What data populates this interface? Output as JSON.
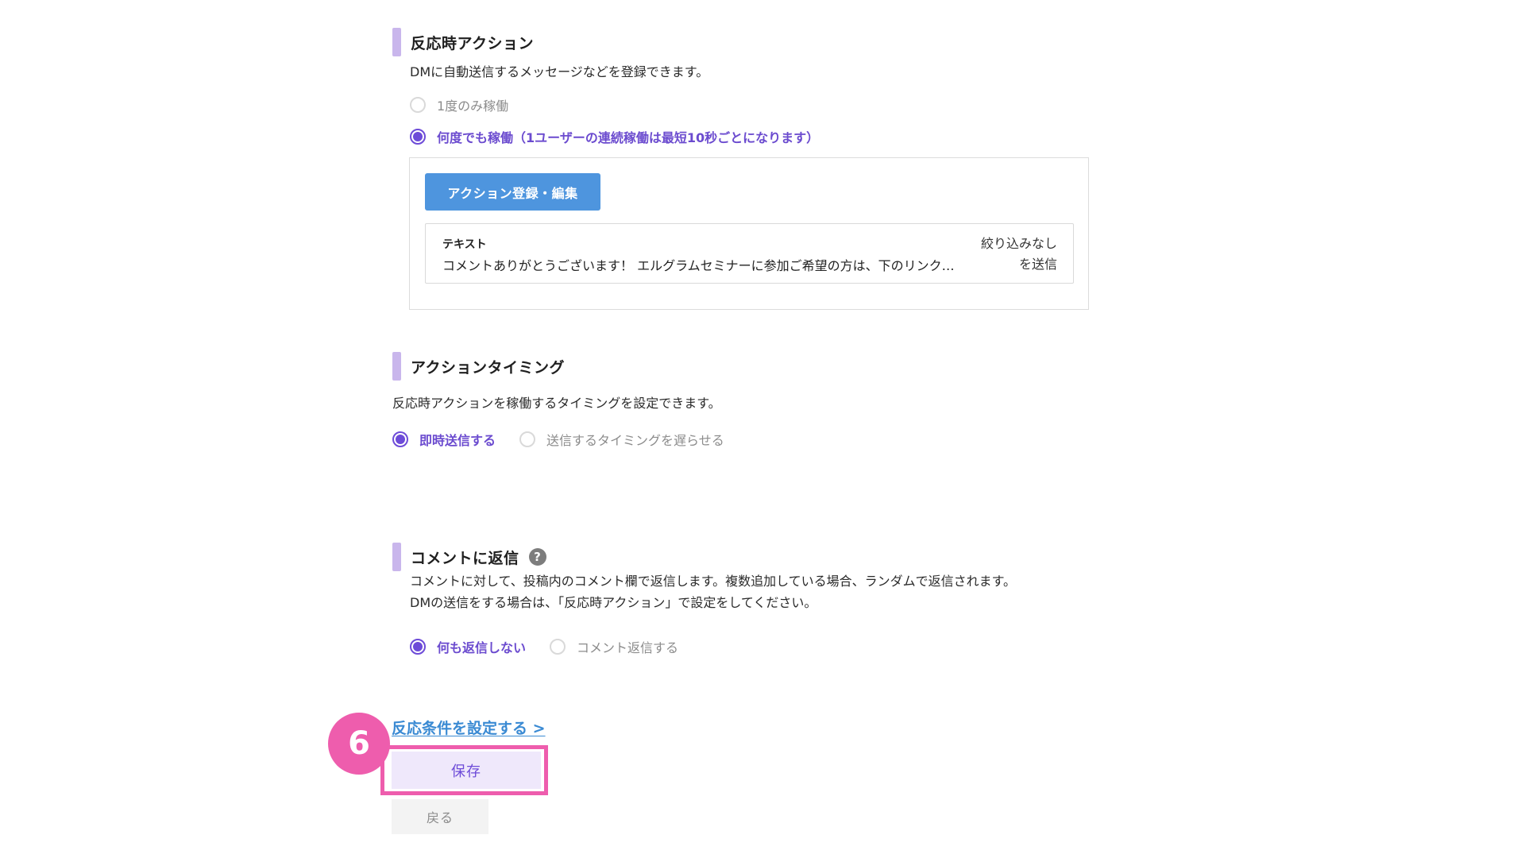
{
  "reaction_action": {
    "title": "反応時アクション",
    "description": "DMに自動送信するメッセージなどを登録できます。",
    "options": [
      {
        "label": "1度のみ稼働",
        "checked": false
      },
      {
        "label": "何度でも稼働（1ユーザーの連続稼働は最短10秒ごとになります）",
        "checked": true
      }
    ],
    "register_button": "アクション登録・編集",
    "item": {
      "type": "テキスト",
      "text": "コメントありがとうございます！ エルグラムセミナーに参加ご希望の方は、下のリンク…",
      "filter_line1": "絞り込みなし",
      "filter_line2": "を送信"
    }
  },
  "action_timing": {
    "title": "アクションタイミング",
    "description": "反応時アクションを稼働するタイミングを設定できます。",
    "options": [
      {
        "label": "即時送信する",
        "checked": true
      },
      {
        "label": "送信するタイミングを遅らせる",
        "checked": false
      }
    ]
  },
  "comment_reply": {
    "title": "コメントに返信",
    "help_icon": "?",
    "description_line1": "コメントに対して、投稿内のコメント欄で返信します。複数追加している場合、ランダムで返信されます。",
    "description_line2": "DMの送信をする場合は、「反応時アクション」で設定をしてください。",
    "options": [
      {
        "label": "何も返信しない",
        "checked": true
      },
      {
        "label": "コメント返信する",
        "checked": false
      }
    ]
  },
  "footer": {
    "condition_link": "反応条件を設定する >",
    "step_number": "6",
    "save_label": "保存",
    "back_label": "戻る"
  },
  "colors": {
    "accent_purple": "#6d4bd8",
    "link_blue": "#3a8ad3",
    "button_blue": "#4e95de",
    "highlight_pink": "#ee5dad"
  }
}
